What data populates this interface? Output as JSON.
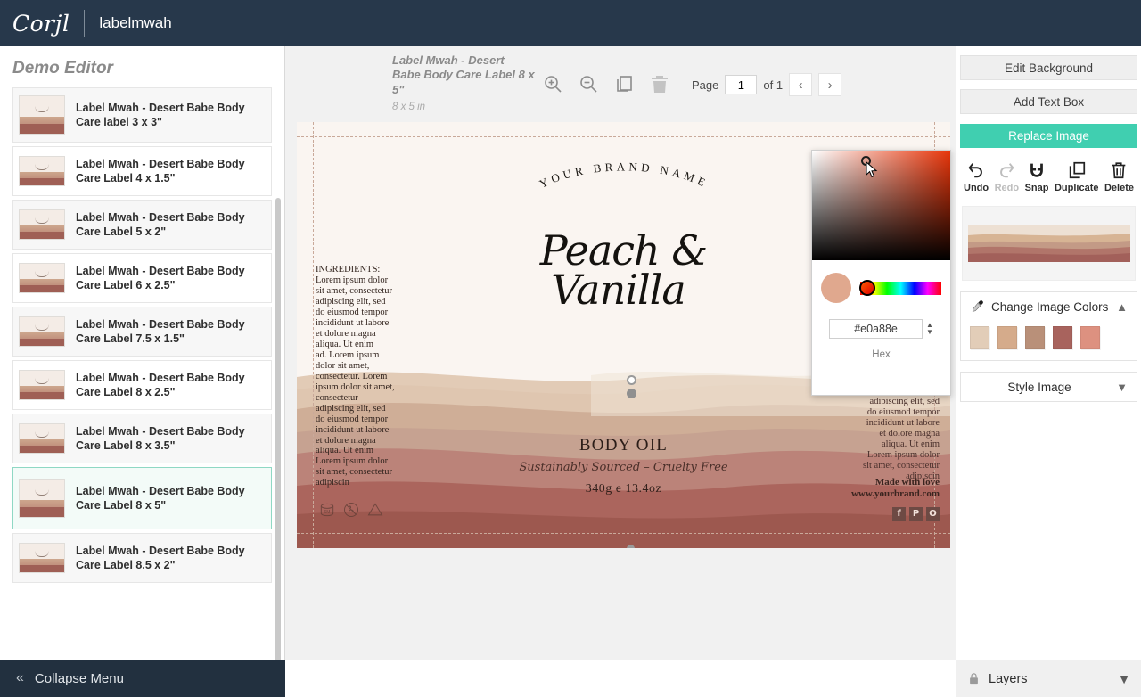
{
  "topbar": {
    "logo_text": "Corjl",
    "document_title": "labelmwah"
  },
  "sidebar": {
    "title": "Demo Editor",
    "collapse_label": "Collapse Menu",
    "collapse_icon": "double-chevron-left-icon",
    "items": [
      {
        "label": "Label Mwah - Desert Babe Body Care label 3 x 3\"",
        "selected": false
      },
      {
        "label": "Label Mwah - Desert Babe Body Care Label 4 x 1.5\"",
        "selected": false
      },
      {
        "label": "Label Mwah - Desert Babe Body Care Label 5 x 2\"",
        "selected": false
      },
      {
        "label": "Label Mwah - Desert Babe Body Care Label 6 x 2.5\"",
        "selected": false
      },
      {
        "label": "Label Mwah - Desert Babe Body Care Label 7.5 x 1.5\"",
        "selected": false
      },
      {
        "label": "Label Mwah - Desert Babe Body Care Label 8 x 2.5\"",
        "selected": false
      },
      {
        "label": "Label Mwah - Desert Babe Body Care Label 8 x 3.5\"",
        "selected": false
      },
      {
        "label": "Label Mwah - Desert Babe Body Care Label 8 x 5\"",
        "selected": true
      },
      {
        "label": "Label Mwah - Desert Babe Body Care Label 8.5 x 2\"",
        "selected": false
      }
    ]
  },
  "canvas_header": {
    "title": "Label Mwah - Desert Babe Body Care Label 8 x 5\"",
    "dimensions": "8 x 5 in",
    "tools": [
      {
        "name": "zoom-in-icon",
        "label": "Zoom In",
        "disabled": false
      },
      {
        "name": "zoom-out-icon",
        "label": "Zoom Out",
        "disabled": false
      },
      {
        "name": "duplicate-icon",
        "label": "Duplicate Page",
        "disabled": false
      },
      {
        "name": "trash-icon",
        "label": "Delete Page",
        "disabled": true
      }
    ],
    "page_label": "Page",
    "page_value": "1",
    "page_of": "of 1",
    "prev_icon": "chevron-left-icon",
    "next_icon": "chevron-right-icon"
  },
  "label_design": {
    "brand_arc": "YOUR BRAND NAME",
    "product_line1": "Peach &",
    "product_line2": "Vanilla",
    "ingredients": "INGREDIENTS:\nLorem ipsum dolor\nsit amet, consectetur\nadipiscing elit, sed\ndo eiusmod tempor\nincididunt ut labore\net dolore magna\naliqua. Ut enim\nad. Lorem ipsum\ndolor sit amet,\nconsectetur. Lorem\nipsum dolor sit amet,\nconsectetur\nadipiscing elit, sed\ndo eiusmod tempor\nincididunt ut labore\net dolore magna\naliqua. Ut enim\nLorem ipsum dolor\nsit amet, consectetur\nadipiscin",
    "right_copy": "consectetur\nadipiscing elit, sed\ndo eiusmod tempor\nincididunt ut labore\net dolore magna\naliqua. Ut enim\nLorem ipsum dolor\nsit amet, consectetur\nadipiscin",
    "made_with": "Made with love\nwww.yourbrand.com",
    "socials": [
      {
        "name": "facebook-icon",
        "glyph": "f"
      },
      {
        "name": "pinterest-icon",
        "glyph": "P"
      },
      {
        "name": "instagram-icon",
        "glyph": "O"
      }
    ],
    "product_type": "BODY OIL",
    "tagline": "Sustainably Sourced – Cruelty Free",
    "net_weight": "340g e 13.4oz",
    "eco_icons": [
      "period-after-opening-icon",
      "not-tested-on-animals-icon",
      "recycling-triangle-icon"
    ],
    "background_color": "#faf5f1",
    "wave_colors": [
      "#e7d7c6",
      "#d8b79b",
      "#c9a08a",
      "#bd8c7c",
      "#b4766b",
      "#a8635d",
      "#9a5a51"
    ]
  },
  "color_picker": {
    "hex_value": "#e0a88e",
    "hex_label": "Hex",
    "selected_color": "#e0a88e",
    "hue_color": "#e8350a",
    "spinner_icon": "spinner-arrows-icon",
    "cursor_icon": "pointer-cursor-icon"
  },
  "right_panel": {
    "edit_background_label": "Edit Background",
    "add_text_box_label": "Add Text Box",
    "replace_image_label": "Replace Image",
    "replace_image_color": "#40cfb0",
    "actions": [
      {
        "label": "Undo",
        "icon": "undo-icon",
        "disabled": false
      },
      {
        "label": "Redo",
        "icon": "redo-icon",
        "disabled": true
      },
      {
        "label": "Snap",
        "icon": "magnet-icon",
        "disabled": false
      },
      {
        "label": "Duplicate",
        "icon": "duplicate-icon",
        "disabled": false
      },
      {
        "label": "Delete",
        "icon": "trash-icon",
        "disabled": false
      }
    ],
    "change_image_colors": {
      "label": "Change Image Colors",
      "icon": "eyedropper-icon",
      "chevron": "chevron-up-icon",
      "swatches": [
        "#e2cdb8",
        "#d5ab8b",
        "#b99079",
        "#a8635d",
        "#dd9180"
      ]
    },
    "style_image": {
      "label": "Style Image",
      "chevron": "chevron-down-icon"
    }
  },
  "layers_bar": {
    "label": "Layers",
    "icon": "lock-icon",
    "chevron": "chevron-down-icon"
  }
}
